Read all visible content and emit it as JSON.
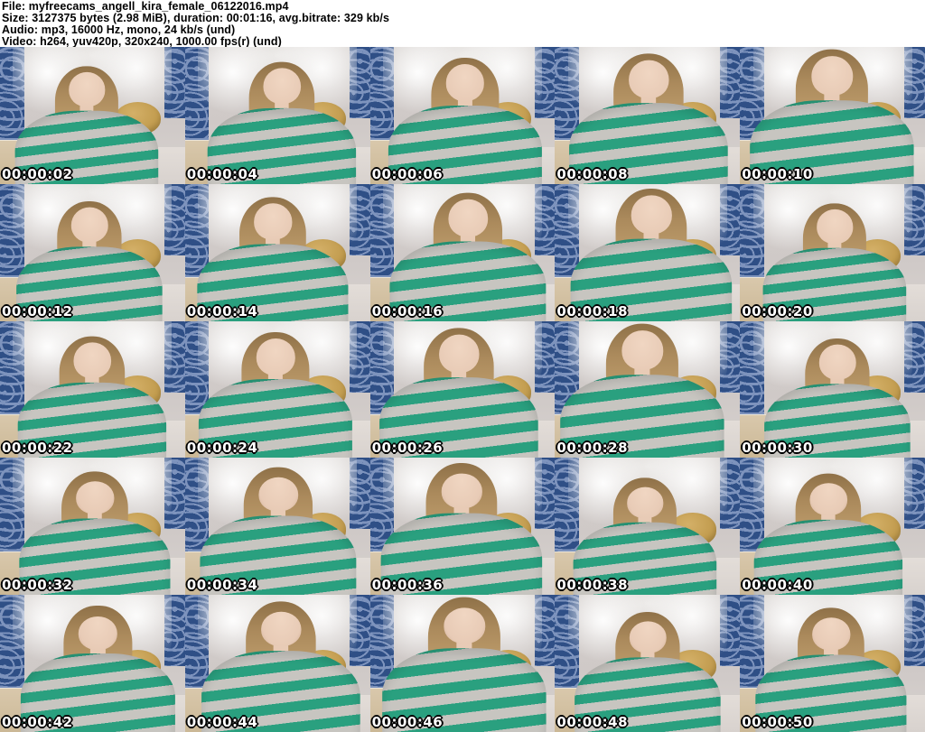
{
  "header": {
    "lines": [
      "File: myfreecams_angell_kira_female_06122016.mp4",
      "Size: 3127375 bytes (2.98 MiB), duration: 00:01:16, avg.bitrate: 329 kb/s",
      "Audio: mp3, 16000 Hz, mono, 24 kb/s (und)",
      "Video: h264, yuv420p, 320x240, 1000.00 fps(r) (und)"
    ]
  },
  "grid": {
    "rows": 5,
    "columns": 5,
    "thumbnails": [
      {
        "timestamp": "00:00:02"
      },
      {
        "timestamp": "00:00:04"
      },
      {
        "timestamp": "00:00:06"
      },
      {
        "timestamp": "00:00:08"
      },
      {
        "timestamp": "00:00:10"
      },
      {
        "timestamp": "00:00:12"
      },
      {
        "timestamp": "00:00:14"
      },
      {
        "timestamp": "00:00:16"
      },
      {
        "timestamp": "00:00:18"
      },
      {
        "timestamp": "00:00:20"
      },
      {
        "timestamp": "00:00:22"
      },
      {
        "timestamp": "00:00:24"
      },
      {
        "timestamp": "00:00:26"
      },
      {
        "timestamp": "00:00:28"
      },
      {
        "timestamp": "00:00:30"
      },
      {
        "timestamp": "00:00:32"
      },
      {
        "timestamp": "00:00:34"
      },
      {
        "timestamp": "00:00:36"
      },
      {
        "timestamp": "00:00:38"
      },
      {
        "timestamp": "00:00:40"
      },
      {
        "timestamp": "00:00:42"
      },
      {
        "timestamp": "00:00:44"
      },
      {
        "timestamp": "00:00:46"
      },
      {
        "timestamp": "00:00:48"
      },
      {
        "timestamp": "00:00:50"
      }
    ]
  },
  "colors": {
    "stripe_green": "#2aa07f",
    "stripe_gray": "#c7c5c0",
    "hair_blonde": "#ab8a5c",
    "skin": "#e8cbb6",
    "wallpaper_blue": "#2f4f86",
    "pillow_tan": "#c09a4c",
    "curtain_white": "#edebe9",
    "room_base": "#cfc9c7",
    "header_bg": "#ffffff",
    "header_text": "#000000",
    "timestamp_text": "#ffffff"
  }
}
